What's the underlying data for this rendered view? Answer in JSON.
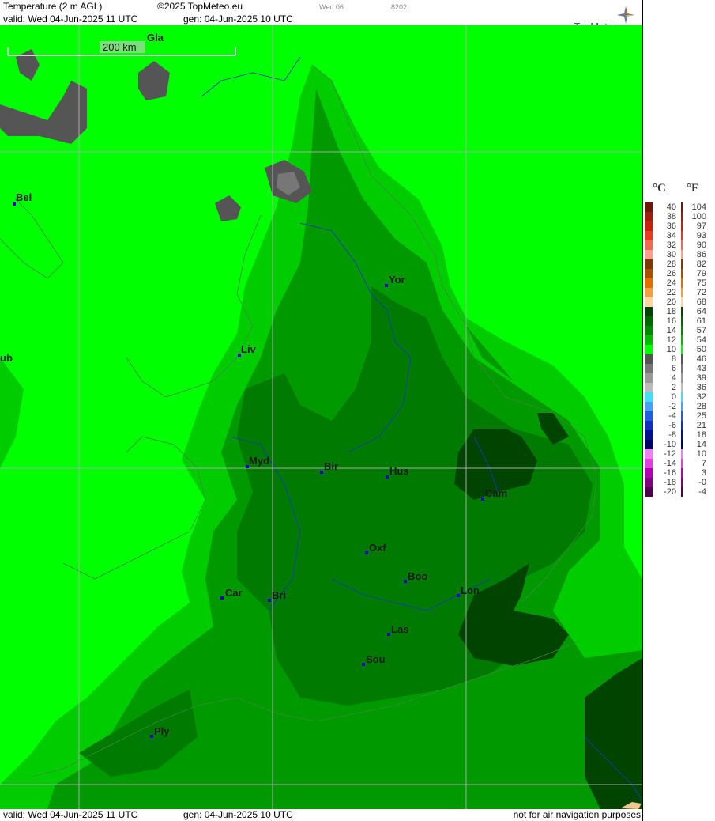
{
  "header": {
    "parameter": "Temperature (2 m AGL)",
    "copyright": "©2025 TopMeteo.eu",
    "small_day": "Wed 06",
    "small_code": "8202",
    "valid": "valid:  Wed  04-Jun-2025  11 UTC",
    "generated": "gen: 04-Jun-2025 10 UTC",
    "logo": "TopMeteo"
  },
  "footer": {
    "valid": "valid:  Wed  04-Jun-2025  11 UTC",
    "generated": "gen: 04-Jun-2025 10 UTC",
    "disclaimer": "not for air navigation purposes"
  },
  "scale_bar": {
    "label": "200 km"
  },
  "cities": [
    {
      "label": "Gla"
    },
    {
      "label": "Bel"
    },
    {
      "label": "Yor"
    },
    {
      "label": "Liv"
    },
    {
      "label": "ub"
    },
    {
      "label": "Myd"
    },
    {
      "label": "Bir"
    },
    {
      "label": "Hus"
    },
    {
      "label": "Cam"
    },
    {
      "label": "Oxf"
    },
    {
      "label": "Boo"
    },
    {
      "label": "Lon"
    },
    {
      "label": "Car"
    },
    {
      "label": "Bri"
    },
    {
      "label": "Las"
    },
    {
      "label": "Sou"
    },
    {
      "label": "Ply"
    }
  ],
  "legend": {
    "celsius_header": "°C",
    "fahrenheit_header": "°F",
    "rows": [
      {
        "c": "40",
        "f": "104",
        "color": "#6b1a0a"
      },
      {
        "c": "38",
        "f": "100",
        "color": "#9c1e0c"
      },
      {
        "c": "36",
        "f": "97",
        "color": "#c8200e"
      },
      {
        "c": "34",
        "f": "93",
        "color": "#e83a20"
      },
      {
        "c": "32",
        "f": "90",
        "color": "#f06a50"
      },
      {
        "c": "30",
        "f": "86",
        "color": "#f8a090"
      },
      {
        "c": "28",
        "f": "82",
        "color": "#7a3a00"
      },
      {
        "c": "26",
        "f": "79",
        "color": "#a85200"
      },
      {
        "c": "24",
        "f": "75",
        "color": "#e07000"
      },
      {
        "c": "22",
        "f": "72",
        "color": "#f0a040"
      },
      {
        "c": "20",
        "f": "68",
        "color": "#f8d8a0"
      },
      {
        "c": "18",
        "f": "64",
        "color": "#004400"
      },
      {
        "c": "16",
        "f": "61",
        "color": "#006600"
      },
      {
        "c": "14",
        "f": "57",
        "color": "#008800"
      },
      {
        "c": "12",
        "f": "54",
        "color": "#00bb00"
      },
      {
        "c": "10",
        "f": "50",
        "color": "#00ff00"
      },
      {
        "c": "8",
        "f": "46",
        "color": "#555555"
      },
      {
        "c": "6",
        "f": "43",
        "color": "#777777"
      },
      {
        "c": "4",
        "f": "39",
        "color": "#999999"
      },
      {
        "c": "2",
        "f": "36",
        "color": "#bbbbbb"
      },
      {
        "c": "0",
        "f": "32",
        "color": "#40e0f0"
      },
      {
        "c": "-2",
        "f": "28",
        "color": "#4aa0f0"
      },
      {
        "c": "-4",
        "f": "25",
        "color": "#2060e0"
      },
      {
        "c": "-6",
        "f": "21",
        "color": "#1030c0"
      },
      {
        "c": "-8",
        "f": "18",
        "color": "#001090"
      },
      {
        "c": "-10",
        "f": "14",
        "color": "#000060"
      },
      {
        "c": "-12",
        "f": "10",
        "color": "#f080f0"
      },
      {
        "c": "-14",
        "f": "7",
        "color": "#e040e0"
      },
      {
        "c": "-16",
        "f": "3",
        "color": "#b000b0"
      },
      {
        "c": "-18",
        "f": "-0",
        "color": "#800080"
      },
      {
        "c": "-20",
        "f": "-4",
        "color": "#500050"
      }
    ]
  },
  "colors": {
    "t10": "#00ff00",
    "t12": "#00cc00",
    "t14": "#009a00",
    "t16": "#007a00",
    "t18": "#004400",
    "t8": "#555555",
    "t6": "#777777",
    "city_dot": "#0000cc",
    "grid": "#aaaaaa"
  }
}
